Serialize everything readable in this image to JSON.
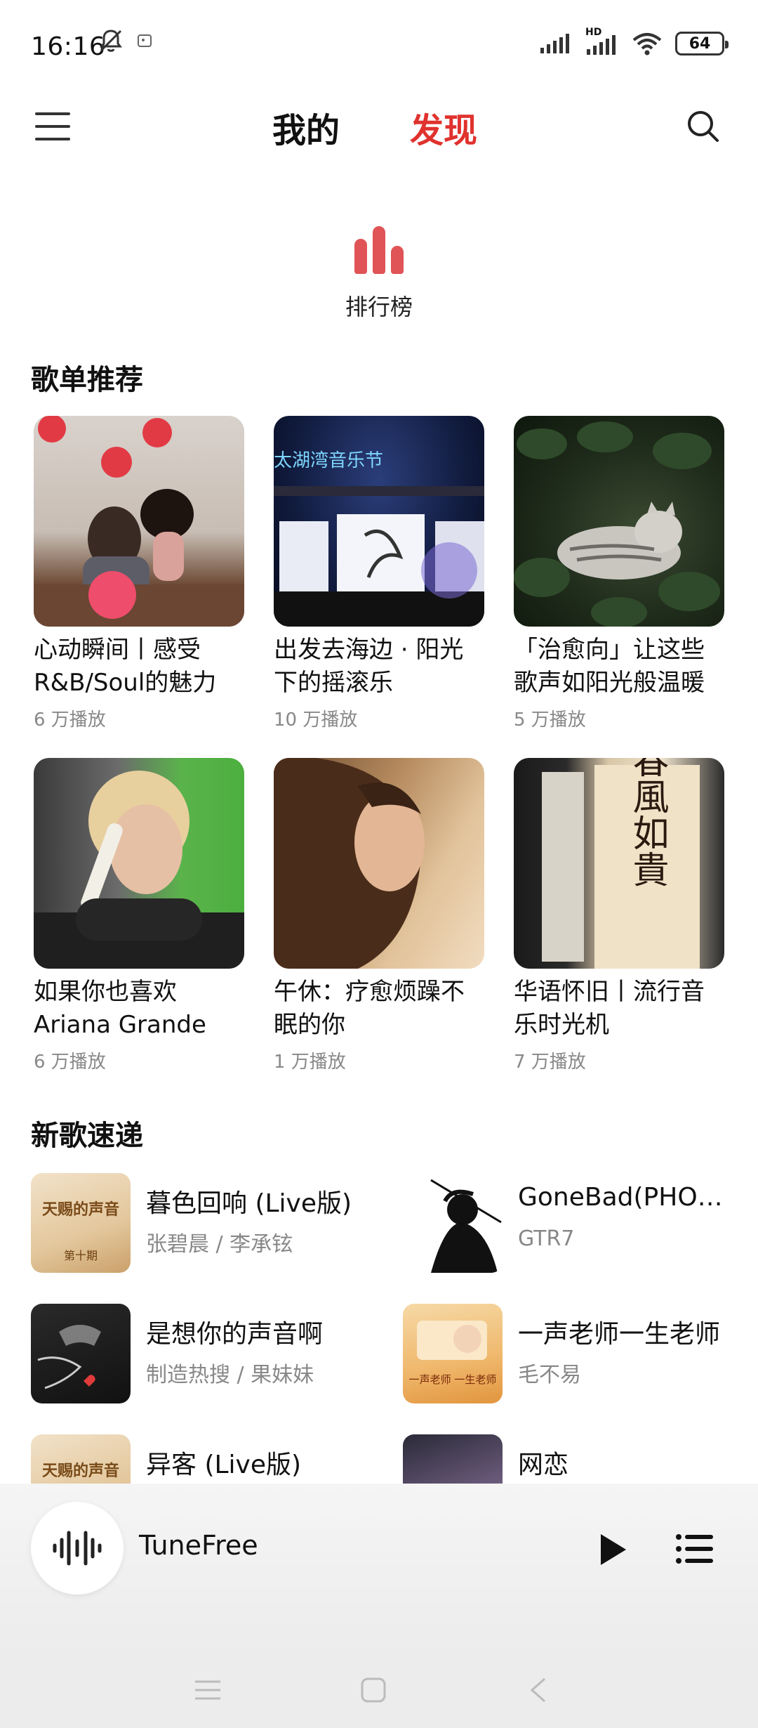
{
  "status": {
    "time": "16:16",
    "network_label": "HD",
    "battery": "64"
  },
  "header": {
    "tabs": [
      {
        "label": "我的"
      },
      {
        "label": "发现"
      }
    ]
  },
  "ranking": {
    "label": "排行榜"
  },
  "playlists": {
    "section_title": "歌单推荐",
    "items": [
      {
        "title": "心动瞬间丨感受R&B/Soul的魅力",
        "plays": "6 万播放"
      },
      {
        "title": "出发去海边 · 阳光下的摇滚乐",
        "plays": "10 万播放"
      },
      {
        "title": "「治愈向」让这些歌声如阳光般温暖",
        "plays": "5 万播放"
      },
      {
        "title": "如果你也喜欢Ariana Grande",
        "plays": "6 万播放"
      },
      {
        "title": "午休：疗愈烦躁不眠的你",
        "plays": "1 万播放"
      },
      {
        "title": "华语怀旧丨流行音乐时光机",
        "plays": "7 万播放"
      }
    ],
    "cover2_text": "太湖湾音乐节",
    "cover6_text": "春風如貴"
  },
  "new_songs": {
    "section_title": "新歌速递",
    "items": [
      {
        "title": "暮色回响 (Live版)",
        "artist": "张碧晨 / 李承铉",
        "cover_text": "天赐的声音",
        "cover_sub": "第十期"
      },
      {
        "title": "GoneBad(PHONK)",
        "artist": "GTR7"
      },
      {
        "title": "是想你的声音啊",
        "artist": "制造热搜 / 果妹妹"
      },
      {
        "title": "一声老师一生老师",
        "artist": "毛不易",
        "cover_text": "一声老师 一生老师"
      },
      {
        "title": "异客 (Live版)",
        "artist": "",
        "cover_text": "天赐的声音"
      },
      {
        "title": "网恋",
        "artist": ""
      }
    ]
  },
  "player": {
    "title": "TuneFree"
  },
  "colors": {
    "accent": "#e0322e",
    "ranking_icon": "#e05356"
  }
}
